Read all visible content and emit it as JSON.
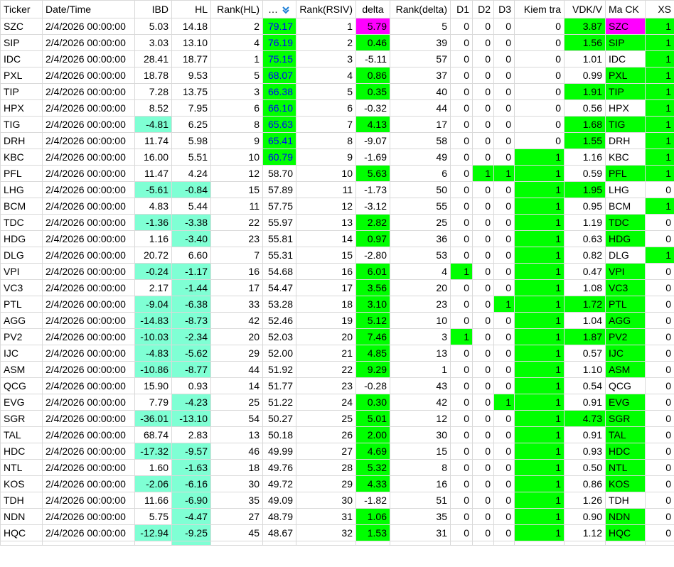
{
  "columns": [
    "Ticker",
    "Date/Time",
    "IBD",
    "HL",
    "Rank(HL)",
    "…",
    "Rank(RSIV)",
    "delta",
    "Rank(delta)",
    "D1",
    "D2",
    "D3",
    "Kiem tra",
    "VDK/V",
    "Ma CK",
    "XS"
  ],
  "sort_icon": "sort-descending-icon",
  "colors": {
    "green": "#00ff00",
    "aqua": "#7fffd4",
    "magenta": "#ff00ff",
    "blue_text": "#0000ff"
  },
  "rows": [
    {
      "ticker": "SZC",
      "date": "2/4/2026 00:00:00",
      "ibd": "5.03",
      "hl": "14.18",
      "rank_hl": "2",
      "rsiv": "79.17",
      "rank_rsiv": "1",
      "delta": "5.79",
      "rank_delta": "5",
      "d1": "0",
      "d2": "0",
      "d3": "0",
      "kiem_tra": "0",
      "vdk_v": "3.87",
      "ma_ck": "SZC",
      "xs": "1"
    },
    {
      "ticker": "SIP",
      "date": "2/4/2026 00:00:00",
      "ibd": "3.03",
      "hl": "13.10",
      "rank_hl": "4",
      "rsiv": "76.19",
      "rank_rsiv": "2",
      "delta": "0.46",
      "rank_delta": "39",
      "d1": "0",
      "d2": "0",
      "d3": "0",
      "kiem_tra": "0",
      "vdk_v": "1.56",
      "ma_ck": "SIP",
      "xs": "1"
    },
    {
      "ticker": "IDC",
      "date": "2/4/2026 00:00:00",
      "ibd": "28.41",
      "hl": "18.77",
      "rank_hl": "1",
      "rsiv": "75.15",
      "rank_rsiv": "3",
      "delta": "-5.11",
      "rank_delta": "57",
      "d1": "0",
      "d2": "0",
      "d3": "0",
      "kiem_tra": "0",
      "vdk_v": "1.01",
      "ma_ck": "IDC",
      "xs": "1"
    },
    {
      "ticker": "PXL",
      "date": "2/4/2026 00:00:00",
      "ibd": "18.78",
      "hl": "9.53",
      "rank_hl": "5",
      "rsiv": "68.07",
      "rank_rsiv": "4",
      "delta": "0.86",
      "rank_delta": "37",
      "d1": "0",
      "d2": "0",
      "d3": "0",
      "kiem_tra": "0",
      "vdk_v": "0.99",
      "ma_ck": "PXL",
      "xs": "1"
    },
    {
      "ticker": "TIP",
      "date": "2/4/2026 00:00:00",
      "ibd": "7.28",
      "hl": "13.75",
      "rank_hl": "3",
      "rsiv": "66.38",
      "rank_rsiv": "5",
      "delta": "0.35",
      "rank_delta": "40",
      "d1": "0",
      "d2": "0",
      "d3": "0",
      "kiem_tra": "0",
      "vdk_v": "1.91",
      "ma_ck": "TIP",
      "xs": "1"
    },
    {
      "ticker": "HPX",
      "date": "2/4/2026 00:00:00",
      "ibd": "8.52",
      "hl": "7.95",
      "rank_hl": "6",
      "rsiv": "66.10",
      "rank_rsiv": "6",
      "delta": "-0.32",
      "rank_delta": "44",
      "d1": "0",
      "d2": "0",
      "d3": "0",
      "kiem_tra": "0",
      "vdk_v": "0.56",
      "ma_ck": "HPX",
      "xs": "1"
    },
    {
      "ticker": "TIG",
      "date": "2/4/2026 00:00:00",
      "ibd": "-4.81",
      "hl": "6.25",
      "rank_hl": "8",
      "rsiv": "65.63",
      "rank_rsiv": "7",
      "delta": "4.13",
      "rank_delta": "17",
      "d1": "0",
      "d2": "0",
      "d3": "0",
      "kiem_tra": "0",
      "vdk_v": "1.68",
      "ma_ck": "TIG",
      "xs": "1"
    },
    {
      "ticker": "DRH",
      "date": "2/4/2026 00:00:00",
      "ibd": "11.74",
      "hl": "5.98",
      "rank_hl": "9",
      "rsiv": "65.41",
      "rank_rsiv": "8",
      "delta": "-9.07",
      "rank_delta": "58",
      "d1": "0",
      "d2": "0",
      "d3": "0",
      "kiem_tra": "0",
      "vdk_v": "1.55",
      "ma_ck": "DRH",
      "xs": "1"
    },
    {
      "ticker": "KBC",
      "date": "2/4/2026 00:00:00",
      "ibd": "16.00",
      "hl": "5.51",
      "rank_hl": "10",
      "rsiv": "60.79",
      "rank_rsiv": "9",
      "delta": "-1.69",
      "rank_delta": "49",
      "d1": "0",
      "d2": "0",
      "d3": "0",
      "kiem_tra": "1",
      "vdk_v": "1.16",
      "ma_ck": "KBC",
      "xs": "1"
    },
    {
      "ticker": "PFL",
      "date": "2/4/2026 00:00:00",
      "ibd": "11.47",
      "hl": "4.24",
      "rank_hl": "12",
      "rsiv": "58.70",
      "rank_rsiv": "10",
      "delta": "5.63",
      "rank_delta": "6",
      "d1": "0",
      "d2": "1",
      "d3": "1",
      "kiem_tra": "1",
      "vdk_v": "0.59",
      "ma_ck": "PFL",
      "xs": "1"
    },
    {
      "ticker": "LHG",
      "date": "2/4/2026 00:00:00",
      "ibd": "-5.61",
      "hl": "-0.84",
      "rank_hl": "15",
      "rsiv": "57.89",
      "rank_rsiv": "11",
      "delta": "-1.73",
      "rank_delta": "50",
      "d1": "0",
      "d2": "0",
      "d3": "0",
      "kiem_tra": "1",
      "vdk_v": "1.95",
      "ma_ck": "LHG",
      "xs": "0"
    },
    {
      "ticker": "BCM",
      "date": "2/4/2026 00:00:00",
      "ibd": "4.83",
      "hl": "5.44",
      "rank_hl": "11",
      "rsiv": "57.75",
      "rank_rsiv": "12",
      "delta": "-3.12",
      "rank_delta": "55",
      "d1": "0",
      "d2": "0",
      "d3": "0",
      "kiem_tra": "1",
      "vdk_v": "0.95",
      "ma_ck": "BCM",
      "xs": "1"
    },
    {
      "ticker": "TDC",
      "date": "2/4/2026 00:00:00",
      "ibd": "-1.36",
      "hl": "-3.38",
      "rank_hl": "22",
      "rsiv": "55.97",
      "rank_rsiv": "13",
      "delta": "2.82",
      "rank_delta": "25",
      "d1": "0",
      "d2": "0",
      "d3": "0",
      "kiem_tra": "1",
      "vdk_v": "1.19",
      "ma_ck": "TDC",
      "xs": "0"
    },
    {
      "ticker": "HDG",
      "date": "2/4/2026 00:00:00",
      "ibd": "1.16",
      "hl": "-3.40",
      "rank_hl": "23",
      "rsiv": "55.81",
      "rank_rsiv": "14",
      "delta": "0.97",
      "rank_delta": "36",
      "d1": "0",
      "d2": "0",
      "d3": "0",
      "kiem_tra": "1",
      "vdk_v": "0.63",
      "ma_ck": "HDG",
      "xs": "0"
    },
    {
      "ticker": "DLG",
      "date": "2/4/2026 00:00:00",
      "ibd": "20.72",
      "hl": "6.60",
      "rank_hl": "7",
      "rsiv": "55.31",
      "rank_rsiv": "15",
      "delta": "-2.80",
      "rank_delta": "53",
      "d1": "0",
      "d2": "0",
      "d3": "0",
      "kiem_tra": "1",
      "vdk_v": "0.82",
      "ma_ck": "DLG",
      "xs": "1"
    },
    {
      "ticker": "VPI",
      "date": "2/4/2026 00:00:00",
      "ibd": "-0.24",
      "hl": "-1.17",
      "rank_hl": "16",
      "rsiv": "54.68",
      "rank_rsiv": "16",
      "delta": "6.01",
      "rank_delta": "4",
      "d1": "1",
      "d2": "0",
      "d3": "0",
      "kiem_tra": "1",
      "vdk_v": "0.47",
      "ma_ck": "VPI",
      "xs": "0"
    },
    {
      "ticker": "VC3",
      "date": "2/4/2026 00:00:00",
      "ibd": "2.17",
      "hl": "-1.44",
      "rank_hl": "17",
      "rsiv": "54.47",
      "rank_rsiv": "17",
      "delta": "3.56",
      "rank_delta": "20",
      "d1": "0",
      "d2": "0",
      "d3": "0",
      "kiem_tra": "1",
      "vdk_v": "1.08",
      "ma_ck": "VC3",
      "xs": "0"
    },
    {
      "ticker": "PTL",
      "date": "2/4/2026 00:00:00",
      "ibd": "-9.04",
      "hl": "-6.38",
      "rank_hl": "33",
      "rsiv": "53.28",
      "rank_rsiv": "18",
      "delta": "3.10",
      "rank_delta": "23",
      "d1": "0",
      "d2": "0",
      "d3": "1",
      "kiem_tra": "1",
      "vdk_v": "1.72",
      "ma_ck": "PTL",
      "xs": "0"
    },
    {
      "ticker": "AGG",
      "date": "2/4/2026 00:00:00",
      "ibd": "-14.83",
      "hl": "-8.73",
      "rank_hl": "42",
      "rsiv": "52.46",
      "rank_rsiv": "19",
      "delta": "5.12",
      "rank_delta": "10",
      "d1": "0",
      "d2": "0",
      "d3": "0",
      "kiem_tra": "1",
      "vdk_v": "1.04",
      "ma_ck": "AGG",
      "xs": "0"
    },
    {
      "ticker": "PV2",
      "date": "2/4/2026 00:00:00",
      "ibd": "-10.03",
      "hl": "-2.34",
      "rank_hl": "20",
      "rsiv": "52.03",
      "rank_rsiv": "20",
      "delta": "7.46",
      "rank_delta": "3",
      "d1": "1",
      "d2": "0",
      "d3": "0",
      "kiem_tra": "1",
      "vdk_v": "1.87",
      "ma_ck": "PV2",
      "xs": "0"
    },
    {
      "ticker": "IJC",
      "date": "2/4/2026 00:00:00",
      "ibd": "-4.83",
      "hl": "-5.62",
      "rank_hl": "29",
      "rsiv": "52.00",
      "rank_rsiv": "21",
      "delta": "4.85",
      "rank_delta": "13",
      "d1": "0",
      "d2": "0",
      "d3": "0",
      "kiem_tra": "1",
      "vdk_v": "0.57",
      "ma_ck": "IJC",
      "xs": "0"
    },
    {
      "ticker": "ASM",
      "date": "2/4/2026 00:00:00",
      "ibd": "-10.86",
      "hl": "-8.77",
      "rank_hl": "44",
      "rsiv": "51.92",
      "rank_rsiv": "22",
      "delta": "9.29",
      "rank_delta": "1",
      "d1": "0",
      "d2": "0",
      "d3": "0",
      "kiem_tra": "1",
      "vdk_v": "1.10",
      "ma_ck": "ASM",
      "xs": "0"
    },
    {
      "ticker": "QCG",
      "date": "2/4/2026 00:00:00",
      "ibd": "15.90",
      "hl": "0.93",
      "rank_hl": "14",
      "rsiv": "51.77",
      "rank_rsiv": "23",
      "delta": "-0.28",
      "rank_delta": "43",
      "d1": "0",
      "d2": "0",
      "d3": "0",
      "kiem_tra": "1",
      "vdk_v": "0.54",
      "ma_ck": "QCG",
      "xs": "0"
    },
    {
      "ticker": "EVG",
      "date": "2/4/2026 00:00:00",
      "ibd": "7.79",
      "hl": "-4.23",
      "rank_hl": "25",
      "rsiv": "51.22",
      "rank_rsiv": "24",
      "delta": "0.30",
      "rank_delta": "42",
      "d1": "0",
      "d2": "0",
      "d3": "1",
      "kiem_tra": "1",
      "vdk_v": "0.91",
      "ma_ck": "EVG",
      "xs": "0"
    },
    {
      "ticker": "SGR",
      "date": "2/4/2026 00:00:00",
      "ibd": "-36.01",
      "hl": "-13.10",
      "rank_hl": "54",
      "rsiv": "50.27",
      "rank_rsiv": "25",
      "delta": "5.01",
      "rank_delta": "12",
      "d1": "0",
      "d2": "0",
      "d3": "0",
      "kiem_tra": "1",
      "vdk_v": "4.73",
      "ma_ck": "SGR",
      "xs": "0"
    },
    {
      "ticker": "TAL",
      "date": "2/4/2026 00:00:00",
      "ibd": "68.74",
      "hl": "2.83",
      "rank_hl": "13",
      "rsiv": "50.18",
      "rank_rsiv": "26",
      "delta": "2.00",
      "rank_delta": "30",
      "d1": "0",
      "d2": "0",
      "d3": "0",
      "kiem_tra": "1",
      "vdk_v": "0.91",
      "ma_ck": "TAL",
      "xs": "0"
    },
    {
      "ticker": "HDC",
      "date": "2/4/2026 00:00:00",
      "ibd": "-17.32",
      "hl": "-9.57",
      "rank_hl": "46",
      "rsiv": "49.99",
      "rank_rsiv": "27",
      "delta": "4.69",
      "rank_delta": "15",
      "d1": "0",
      "d2": "0",
      "d3": "0",
      "kiem_tra": "1",
      "vdk_v": "0.93",
      "ma_ck": "HDC",
      "xs": "0"
    },
    {
      "ticker": "NTL",
      "date": "2/4/2026 00:00:00",
      "ibd": "1.60",
      "hl": "-1.63",
      "rank_hl": "18",
      "rsiv": "49.76",
      "rank_rsiv": "28",
      "delta": "5.32",
      "rank_delta": "8",
      "d1": "0",
      "d2": "0",
      "d3": "0",
      "kiem_tra": "1",
      "vdk_v": "0.50",
      "ma_ck": "NTL",
      "xs": "0"
    },
    {
      "ticker": "KOS",
      "date": "2/4/2026 00:00:00",
      "ibd": "-2.06",
      "hl": "-6.16",
      "rank_hl": "30",
      "rsiv": "49.72",
      "rank_rsiv": "29",
      "delta": "4.33",
      "rank_delta": "16",
      "d1": "0",
      "d2": "0",
      "d3": "0",
      "kiem_tra": "1",
      "vdk_v": "0.86",
      "ma_ck": "KOS",
      "xs": "0"
    },
    {
      "ticker": "TDH",
      "date": "2/4/2026 00:00:00",
      "ibd": "11.66",
      "hl": "-6.90",
      "rank_hl": "35",
      "rsiv": "49.09",
      "rank_rsiv": "30",
      "delta": "-1.82",
      "rank_delta": "51",
      "d1": "0",
      "d2": "0",
      "d3": "0",
      "kiem_tra": "1",
      "vdk_v": "1.26",
      "ma_ck": "TDH",
      "xs": "0"
    },
    {
      "ticker": "NDN",
      "date": "2/4/2026 00:00:00",
      "ibd": "5.75",
      "hl": "-4.47",
      "rank_hl": "27",
      "rsiv": "48.79",
      "rank_rsiv": "31",
      "delta": "1.06",
      "rank_delta": "35",
      "d1": "0",
      "d2": "0",
      "d3": "0",
      "kiem_tra": "1",
      "vdk_v": "0.90",
      "ma_ck": "NDN",
      "xs": "0"
    },
    {
      "ticker": "HQC",
      "date": "2/4/2026 00:00:00",
      "ibd": "-12.94",
      "hl": "-9.25",
      "rank_hl": "45",
      "rsiv": "48.67",
      "rank_rsiv": "32",
      "delta": "1.53",
      "rank_delta": "31",
      "d1": "0",
      "d2": "0",
      "d3": "0",
      "kiem_tra": "1",
      "vdk_v": "1.12",
      "ma_ck": "HQC",
      "xs": "0"
    }
  ]
}
